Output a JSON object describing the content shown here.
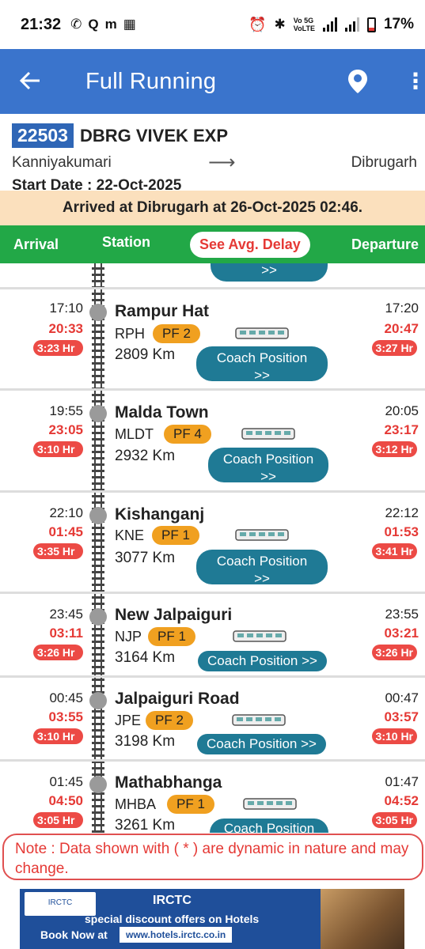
{
  "status_bar": {
    "time": "21:32",
    "left_icons": [
      "whatsapp-icon",
      "search-icon",
      "m-app-icon",
      "calendar-icon"
    ],
    "network1": "Vo 5G",
    "network2": "VoLTE",
    "gen": "5G",
    "battery": "17%"
  },
  "app_bar": {
    "title": "Full Running",
    "back_icon": "back-arrow-icon",
    "location_icon": "location-pin-icon",
    "more_icon": "more-vertical-icon"
  },
  "train": {
    "number": "22503",
    "name": "DBRG VIVEK EXP",
    "from": "Kanniyakumari",
    "to": "Dibrugarh",
    "start_date": "Start Date : 22-Oct-2025"
  },
  "banner": "Arrived at Dibrugarh at 26-Oct-2025 02:46.",
  "columns": {
    "arrival": "Arrival",
    "station": "Station",
    "avg_delay": "See Avg. Delay",
    "departure": "Departure"
  },
  "partial_prev_button": ">>",
  "stops": [
    {
      "name": "Rampur Hat",
      "code": "RPH",
      "pf": "PF 2",
      "km": "2809 Km",
      "sch_arr": "17:10",
      "act_arr": "20:33",
      "delay_arr": "3:23 Hr",
      "sch_dep": "17:20",
      "act_dep": "20:47",
      "delay_dep": "3:27 Hr",
      "coach_line1": "Coach Position",
      "coach_line2": ">>"
    },
    {
      "name": "Malda Town",
      "code": "MLDT",
      "pf": "PF 4",
      "km": "2932 Km",
      "sch_arr": "19:55",
      "act_arr": "23:05",
      "delay_arr": "3:10 Hr",
      "sch_dep": "20:05",
      "act_dep": "23:17",
      "delay_dep": "3:12 Hr",
      "coach_line1": "Coach Position",
      "coach_line2": ">>"
    },
    {
      "name": "Kishanganj",
      "code": "KNE",
      "pf": "PF 1",
      "km": "3077 Km",
      "sch_arr": "22:10",
      "act_arr": "01:45",
      "delay_arr": "3:35 Hr",
      "sch_dep": "22:12",
      "act_dep": "01:53",
      "delay_dep": "3:41 Hr",
      "coach_line1": "Coach Position",
      "coach_line2": ">>"
    },
    {
      "name": "New Jalpaiguri",
      "code": "NJP",
      "pf": "PF 1",
      "km": "3164 Km",
      "sch_arr": "23:45",
      "act_arr": "03:11",
      "delay_arr": "3:26 Hr",
      "sch_dep": "23:55",
      "act_dep": "03:21",
      "delay_dep": "3:26 Hr",
      "coach_single": "Coach Position >>"
    },
    {
      "name": "Jalpaiguri Road",
      "code": "JPE",
      "pf": "PF 2",
      "km": "3198 Km",
      "sch_arr": "00:45",
      "act_arr": "03:55",
      "delay_arr": "3:10 Hr",
      "sch_dep": "00:47",
      "act_dep": "03:57",
      "delay_dep": "3:10 Hr",
      "coach_single": "Coach Position >>"
    },
    {
      "name": "Mathabhanga",
      "code": "MHBA",
      "pf": "PF 1",
      "km": "3261 Km",
      "sch_arr": "01:45",
      "act_arr": "04:50",
      "delay_arr": "3:05 Hr",
      "sch_dep": "01:47",
      "act_dep": "04:52",
      "delay_dep": "3:05 Hr",
      "coach_single": "Coach Position"
    }
  ],
  "note": "Note : Data shown with ( * ) are dynamic in nature and may change.",
  "ad": {
    "logo_text": "IRCTC",
    "brand": "IRCTC",
    "offer": "special discount offers on Hotels",
    "book": "Book Now at",
    "url": "www.hotels.irctc.co.in"
  },
  "colors": {
    "app_bar": "#3a74cc",
    "column_header": "#22a847",
    "delay_badge": "#ec4a45",
    "platform_badge": "#f0a020",
    "coach_button": "#1f7a95",
    "arrived_banner": "#fbe0bd"
  }
}
